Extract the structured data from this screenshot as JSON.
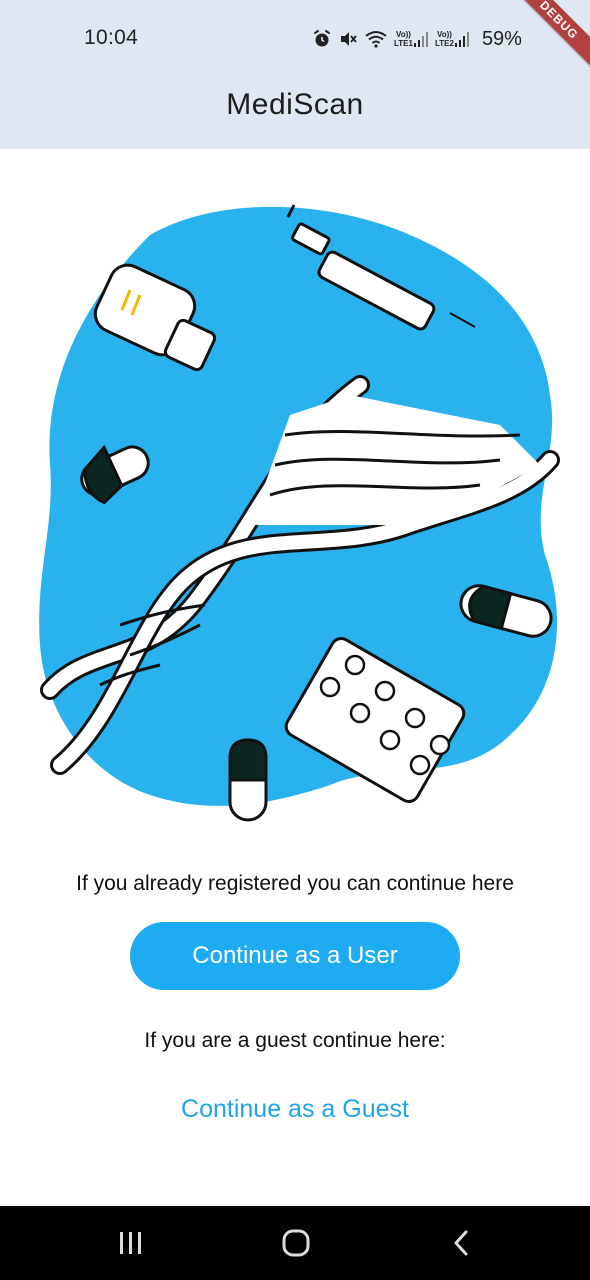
{
  "status_bar": {
    "time": "10:04",
    "icons": [
      "alarm-icon",
      "mute-icon",
      "wifi-icon",
      "signal-icon",
      "signal-icon"
    ],
    "sim1_label_top": "Vo))",
    "sim1_label_bottom": "LTE1",
    "sim2_label_top": "Vo))",
    "sim2_label_bottom": "LTE2",
    "battery": "59%",
    "debug_banner": "DEBUG"
  },
  "app_bar": {
    "title": "MediScan"
  },
  "main": {
    "illustration_icon": "medical-dna-illustration-icon",
    "registered_prompt": "If you already registered you can continue here",
    "user_button_label": "Continue as a User",
    "guest_prompt": "If you are a guest continue here:",
    "guest_link_label": "Continue as a Guest"
  },
  "navigation": {
    "items": [
      "recent-apps-icon",
      "home-icon",
      "back-icon"
    ]
  },
  "colors": {
    "app_bar_bg": "#dfe8f2",
    "accent": "#1eabf1",
    "blob": "#29b2ee",
    "nav_bar_bg": "#000000"
  }
}
